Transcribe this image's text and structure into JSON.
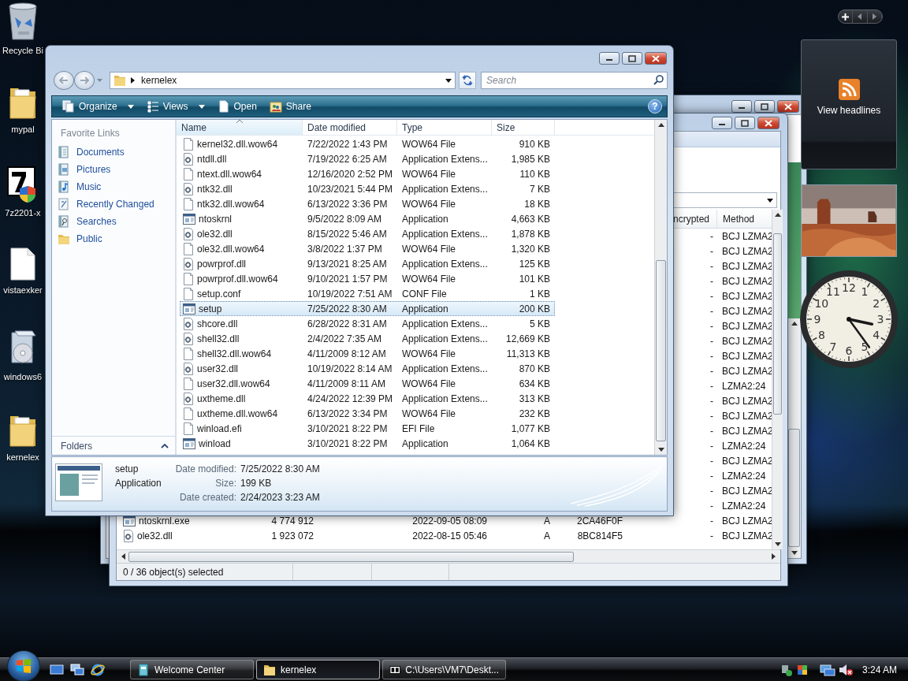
{
  "desktop_icons": [
    {
      "label": "Recycle Bi",
      "kind": "recycle"
    },
    {
      "label": "mypal",
      "kind": "folder"
    },
    {
      "label": "7z2201-x",
      "kind": "installer"
    },
    {
      "label": "vistaexker",
      "kind": "file"
    },
    {
      "label": "windows6",
      "kind": "package"
    },
    {
      "label": "kernelex",
      "kind": "folder"
    }
  ],
  "archive_window": {
    "columns": [
      {
        "label": "ncrypted"
      },
      {
        "label": "Method"
      }
    ],
    "rows": [
      {
        "encrypted": "-",
        "method": "BCJ LZMA2"
      },
      {
        "encrypted": "-",
        "method": "BCJ LZMA2"
      },
      {
        "encrypted": "-",
        "method": "BCJ LZMA2"
      },
      {
        "encrypted": "-",
        "method": "BCJ LZMA2"
      },
      {
        "encrypted": "-",
        "method": "BCJ LZMA2"
      },
      {
        "encrypted": "-",
        "method": "BCJ LZMA2"
      },
      {
        "encrypted": "-",
        "method": "BCJ LZMA2"
      },
      {
        "encrypted": "-",
        "method": "BCJ LZMA2"
      },
      {
        "encrypted": "-",
        "method": "BCJ LZMA2"
      },
      {
        "encrypted": "-",
        "method": "BCJ LZMA2"
      },
      {
        "encrypted": "-",
        "method": "LZMA2:24"
      },
      {
        "encrypted": "-",
        "method": "BCJ LZMA2"
      },
      {
        "encrypted": "-",
        "method": "BCJ LZMA2"
      },
      {
        "encrypted": "-",
        "method": "BCJ LZMA2"
      },
      {
        "encrypted": "-",
        "method": "LZMA2:24"
      },
      {
        "encrypted": "-",
        "method": "BCJ LZMA2"
      },
      {
        "encrypted": "-",
        "method": "LZMA2:24"
      },
      {
        "encrypted": "-",
        "method": "BCJ LZMA2"
      },
      {
        "encrypted": "-",
        "method": "LZMA2:24"
      },
      {
        "kind": "application",
        "name": "ntoskrnl.exe",
        "size": "4 774 912",
        "modified": "2022-09-05 08:09",
        "attributes": "A",
        "crc": "2CA46F0F",
        "encrypted": "-",
        "method": "BCJ LZMA2"
      },
      {
        "kind": "extension",
        "name": "ole32.dll",
        "size": "1 923 072",
        "modified": "2022-08-15 05:46",
        "attributes": "A",
        "crc": "8BC814F5",
        "encrypted": "-",
        "method": "BCJ LZMA2"
      }
    ],
    "status": "0 / 36 object(s) selected"
  },
  "explorer": {
    "location": "kernelex",
    "search_placeholder": "Search",
    "toolbar": [
      {
        "label": "Organize",
        "kind": "organize",
        "menu": true
      },
      {
        "label": "Views",
        "kind": "views",
        "menu": true
      },
      {
        "label": "Open",
        "kind": "open",
        "menu": false
      },
      {
        "label": "Share",
        "kind": "share",
        "menu": false
      }
    ],
    "help": "?",
    "favorites_title": "Favorite Links",
    "favorites": [
      {
        "label": "Documents",
        "kind": "documents"
      },
      {
        "label": "Pictures",
        "kind": "pictures"
      },
      {
        "label": "Music",
        "kind": "music"
      },
      {
        "label": "Recently Changed",
        "kind": "recent"
      },
      {
        "label": "Searches",
        "kind": "searches"
      },
      {
        "label": "Public",
        "kind": "folder"
      }
    ],
    "folders": {
      "label": "Folders",
      "expanded": false
    },
    "columns": [
      {
        "label": "Name",
        "sorted": true
      },
      {
        "label": "Date modified",
        "sorted": false
      },
      {
        "label": "Type",
        "sorted": false
      },
      {
        "label": "Size",
        "sorted": false
      }
    ],
    "files": [
      {
        "name": "kernel32.dll.wow64",
        "modified": "7/22/2022 1:43 PM",
        "type": "WOW64 File",
        "size": "910 KB",
        "kind": "file",
        "selected": false
      },
      {
        "name": "ntdll.dll",
        "modified": "7/19/2022 6:25 AM",
        "type": "Application Extens...",
        "size": "1,985 KB",
        "kind": "extension",
        "selected": false
      },
      {
        "name": "ntext.dll.wow64",
        "modified": "12/16/2020 2:52 PM",
        "type": "WOW64 File",
        "size": "110 KB",
        "kind": "file",
        "selected": false
      },
      {
        "name": "ntk32.dll",
        "modified": "10/23/2021 5:44 PM",
        "type": "Application Extens...",
        "size": "7 KB",
        "kind": "extension",
        "selected": false
      },
      {
        "name": "ntk32.dll.wow64",
        "modified": "6/13/2022 3:36 PM",
        "type": "WOW64 File",
        "size": "18 KB",
        "kind": "file",
        "selected": false
      },
      {
        "name": "ntoskrnl",
        "modified": "9/5/2022 8:09 AM",
        "type": "Application",
        "size": "4,663 KB",
        "kind": "application",
        "selected": false
      },
      {
        "name": "ole32.dll",
        "modified": "8/15/2022 5:46 AM",
        "type": "Application Extens...",
        "size": "1,878 KB",
        "kind": "extension",
        "selected": false
      },
      {
        "name": "ole32.dll.wow64",
        "modified": "3/8/2022 1:37 PM",
        "type": "WOW64 File",
        "size": "1,320 KB",
        "kind": "file",
        "selected": false
      },
      {
        "name": "powrprof.dll",
        "modified": "9/13/2021 8:25 AM",
        "type": "Application Extens...",
        "size": "125 KB",
        "kind": "extension",
        "selected": false
      },
      {
        "name": "powrprof.dll.wow64",
        "modified": "9/10/2021 1:57 PM",
        "type": "WOW64 File",
        "size": "101 KB",
        "kind": "file",
        "selected": false
      },
      {
        "name": "setup.conf",
        "modified": "10/19/2022 7:51 AM",
        "type": "CONF File",
        "size": "1 KB",
        "kind": "file",
        "selected": false
      },
      {
        "name": "setup",
        "modified": "7/25/2022 8:30 AM",
        "type": "Application",
        "size": "200 KB",
        "kind": "application",
        "selected": true
      },
      {
        "name": "shcore.dll",
        "modified": "6/28/2022 8:31 AM",
        "type": "Application Extens...",
        "size": "5 KB",
        "kind": "extension",
        "selected": false
      },
      {
        "name": "shell32.dll",
        "modified": "2/4/2022 7:35 AM",
        "type": "Application Extens...",
        "size": "12,669 KB",
        "kind": "extension",
        "selected": false
      },
      {
        "name": "shell32.dll.wow64",
        "modified": "4/11/2009 8:12 AM",
        "type": "WOW64 File",
        "size": "11,313 KB",
        "kind": "file",
        "selected": false
      },
      {
        "name": "user32.dll",
        "modified": "10/19/2022 8:14 AM",
        "type": "Application Extens...",
        "size": "870 KB",
        "kind": "extension",
        "selected": false
      },
      {
        "name": "user32.dll.wow64",
        "modified": "4/11/2009 8:11 AM",
        "type": "WOW64 File",
        "size": "634 KB",
        "kind": "file",
        "selected": false
      },
      {
        "name": "uxtheme.dll",
        "modified": "4/24/2022 12:39 PM",
        "type": "Application Extens...",
        "size": "313 KB",
        "kind": "extension",
        "selected": false
      },
      {
        "name": "uxtheme.dll.wow64",
        "modified": "6/13/2022 3:34 PM",
        "type": "WOW64 File",
        "size": "232 KB",
        "kind": "file",
        "selected": false
      },
      {
        "name": "winload.efi",
        "modified": "3/10/2021 8:22 PM",
        "type": "EFI File",
        "size": "1,077 KB",
        "kind": "file",
        "selected": false
      },
      {
        "name": "winload",
        "modified": "3/10/2021 8:22 PM",
        "type": "Application",
        "size": "1,064 KB",
        "kind": "application",
        "selected": false
      }
    ],
    "details": {
      "name": "setup",
      "type": "Application",
      "fields": [
        {
          "label": "Date modified:",
          "value": "7/25/2022 8:30 AM"
        },
        {
          "label": "Size:",
          "value": "199 KB"
        },
        {
          "label": "Date created:",
          "value": "2/24/2023 3:23 AM"
        }
      ]
    }
  },
  "gadgets": {
    "feed": {
      "label": "View headlines"
    },
    "clock": {
      "numerals": [
        "12",
        "11",
        "1",
        "10",
        "2",
        "9",
        "3",
        "8",
        "4",
        "7",
        "5",
        "6"
      ]
    }
  },
  "taskbar": {
    "tasks": [
      {
        "label": "Welcome Center",
        "kind": "welcome",
        "selected": false
      },
      {
        "label": "kernelex",
        "kind": "folder",
        "selected": true
      },
      {
        "label": "C:\\Users\\VM7\\Deskt...",
        "kind": "archive",
        "selected": false
      }
    ],
    "time": "3:24 AM"
  }
}
